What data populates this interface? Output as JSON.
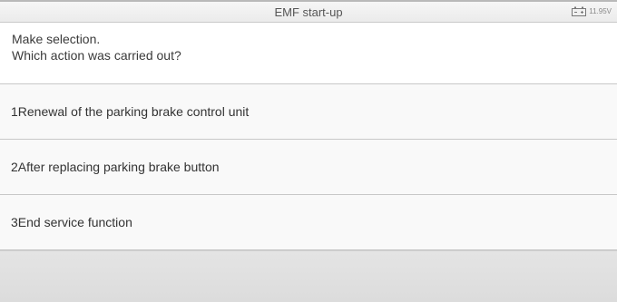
{
  "header": {
    "title": "EMF start-up",
    "battery_voltage": "11.95V",
    "battery_icon": "battery-icon"
  },
  "prompt": {
    "line1": "Make selection.",
    "line2": "Which action was carried out?"
  },
  "options": [
    {
      "label": "1Renewal of the parking brake control unit"
    },
    {
      "label": "2After replacing parking brake button"
    },
    {
      "label": "3End service function"
    }
  ],
  "colors": {
    "header_bg": "#f0f0f0",
    "option_bg": "#f9f9f9",
    "footer_bg": "#e0e0e0",
    "divider": "#c8c8c8"
  }
}
